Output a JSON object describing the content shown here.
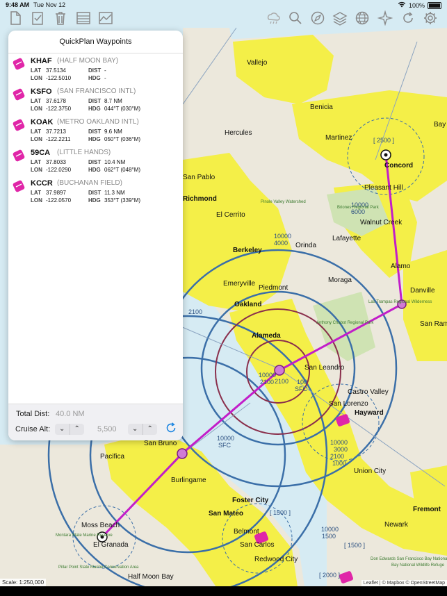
{
  "status": {
    "time": "9:48 AM",
    "date": "Tue Nov 12",
    "battery": "100%"
  },
  "toolbar": {
    "left_icons": [
      "new-plan-icon",
      "checklist-icon",
      "trash-icon",
      "waypoint-list-icon",
      "profile-chart-icon"
    ],
    "right_icons": [
      "weather-icon",
      "search-icon",
      "compass-icon",
      "layers-icon",
      "globe-icon",
      "nav-star-icon",
      "refresh-icon",
      "settings-icon"
    ]
  },
  "panel": {
    "title": "QuickPlan Waypoints",
    "labels": {
      "lat": "LAT",
      "lon": "LON",
      "dist": "DIST",
      "hdg": "HDG"
    },
    "waypoints": [
      {
        "ident": "KHAF",
        "name": "(HALF MOON BAY)",
        "lat": "37.5134",
        "lon": "-122.5010",
        "dist": "-",
        "hdg": "-"
      },
      {
        "ident": "KSFO",
        "name": "(SAN FRANCISCO INTL)",
        "lat": "37.6178",
        "lon": "-122.3750",
        "dist": "8.7 NM",
        "hdg": "044°T (030°M)"
      },
      {
        "ident": "KOAK",
        "name": "(METRO OAKLAND INTL)",
        "lat": "37.7213",
        "lon": "-122.2211",
        "dist": "9.6 NM",
        "hdg": "050°T (036°M)"
      },
      {
        "ident": "59CA",
        "name": "(LITTLE HANDS)",
        "lat": "37.8033",
        "lon": "-122.0290",
        "dist": "10.4 NM",
        "hdg": "062°T (048°M)"
      },
      {
        "ident": "KCCR",
        "name": "(BUCHANAN FIELD)",
        "lat": "37.9897",
        "lon": "-122.0570",
        "dist": "11.3 NM",
        "hdg": "353°T (339°M)"
      }
    ],
    "total_dist_label": "Total Dist:",
    "total_dist_value": "40.0 NM",
    "cruise_alt_label": "Cruise Alt:",
    "cruise_alt_value": "5,500"
  },
  "map": {
    "cities": [
      {
        "text": "Vallejo"
      },
      {
        "text": "Benicia"
      },
      {
        "text": "Martinez"
      },
      {
        "text": "Concord"
      },
      {
        "text": "Hercules"
      },
      {
        "text": "San Pablo"
      },
      {
        "text": "Richmond"
      },
      {
        "text": "El Cerrito"
      },
      {
        "text": "Berkeley"
      },
      {
        "text": "Orinda"
      },
      {
        "text": "Lafayette"
      },
      {
        "text": "Walnut Creek"
      },
      {
        "text": "Pleasant Hill"
      },
      {
        "text": "Emeryville"
      },
      {
        "text": "Piedmont"
      },
      {
        "text": "Oakland"
      },
      {
        "text": "Moraga"
      },
      {
        "text": "Alamo"
      },
      {
        "text": "Danville"
      },
      {
        "text": "San Ramon"
      },
      {
        "text": "Alameda"
      },
      {
        "text": "San Leandro"
      },
      {
        "text": "Castro Valley"
      },
      {
        "text": "Hayward"
      },
      {
        "text": "San Lorenzo"
      },
      {
        "text": "San Bruno"
      },
      {
        "text": "Pacifica"
      },
      {
        "text": "Burlingame"
      },
      {
        "text": "Foster City"
      },
      {
        "text": "San Mateo"
      },
      {
        "text": "Belmont"
      },
      {
        "text": "San Carlos"
      },
      {
        "text": "Redwood City"
      },
      {
        "text": "Union City"
      },
      {
        "text": "Fremont"
      },
      {
        "text": "Newark"
      },
      {
        "text": "Moss Beach"
      },
      {
        "text": "El Granada"
      },
      {
        "text": "Half Moon Bay"
      },
      {
        "text": "Bay Point"
      }
    ],
    "airspace_labels": [
      "[ 2500 ]",
      "10000",
      "6000",
      "10000",
      "4000",
      "2100",
      "2100",
      "10000",
      "2100",
      "100",
      "SFC",
      "10000",
      "SFC",
      "10000",
      "3000",
      "2100",
      "1000",
      "[ 1500 ]",
      "10000",
      "1500",
      "[ 1500 ]",
      "[ 2000 ]"
    ],
    "park_labels": [
      "Pinole Valley Watershed",
      "Briones Regional Park",
      "Las Trampas Regional Wilderness",
      "Anthony Chabot Regional Park",
      "Montara State Marine Reserve",
      "Pillar Point State Marine Conservation Area",
      "Don Edwards San Francisco Bay National Wildlife Refuge",
      "Bay National Wildlife Refuge"
    ],
    "route_color": "#c21ec9",
    "scale": "Scale: 1:250,000",
    "attribution": "Leaflet | © Mapbox © OpenStreetMap"
  }
}
